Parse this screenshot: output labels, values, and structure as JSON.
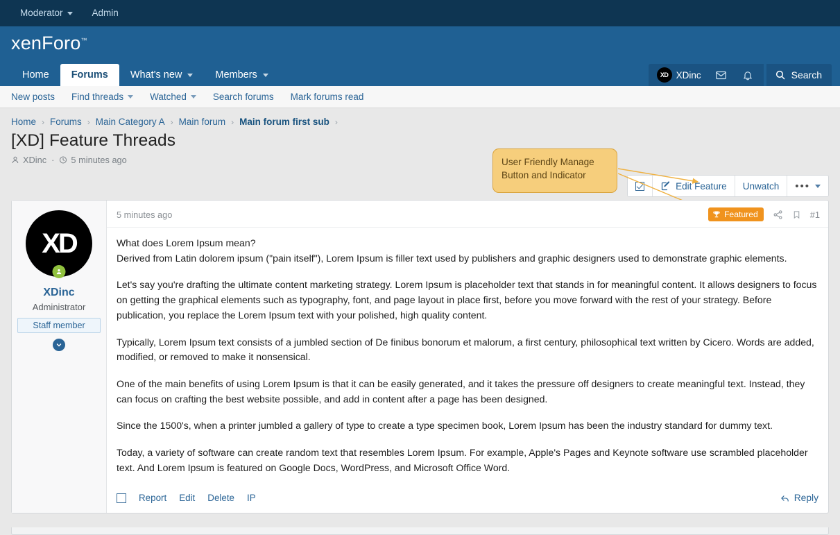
{
  "colors": {
    "top_strip": "#0e3552",
    "header": "#1f6093",
    "accent_link": "#2a6496",
    "featured_badge": "#f0931e",
    "callout_bg": "#f6ce7c",
    "callout_border": "#d9a33d",
    "online": "#90c13e",
    "page_bg": "#e8e8e8"
  },
  "admin_bar": {
    "items": [
      {
        "label": "Moderator",
        "icon": "chevron-down-icon",
        "has_caret": true
      },
      {
        "label": "Admin",
        "has_caret": false
      }
    ]
  },
  "header": {
    "logo_text_light": "xen",
    "logo_text_bold": "Foro",
    "logo_tm": "™",
    "user": {
      "name": "XDinc",
      "avatar_initials": "XD"
    },
    "icons": [
      {
        "name": "mail-icon"
      },
      {
        "name": "bell-icon"
      }
    ],
    "search_label": "Search",
    "search_icon": "search-icon"
  },
  "nav": {
    "tabs": [
      {
        "label": "Home",
        "active": false,
        "caret": false
      },
      {
        "label": "Forums",
        "active": true,
        "caret": false
      },
      {
        "label": "What's new",
        "active": false,
        "caret": true
      },
      {
        "label": "Members",
        "active": false,
        "caret": true
      }
    ]
  },
  "subnav": {
    "items": [
      {
        "label": "New posts",
        "caret": false
      },
      {
        "label": "Find threads",
        "caret": true
      },
      {
        "label": "Watched",
        "caret": true
      },
      {
        "label": "Search forums",
        "caret": false
      },
      {
        "label": "Mark forums read",
        "caret": false
      }
    ]
  },
  "breadcrumb": {
    "items": [
      {
        "label": "Home",
        "current": false
      },
      {
        "label": "Forums",
        "current": false
      },
      {
        "label": "Main Category A",
        "current": false
      },
      {
        "label": "Main forum",
        "current": false
      },
      {
        "label": "Main forum first sub",
        "current": true
      }
    ],
    "separator": "›"
  },
  "thread": {
    "title": "[XD] Feature Threads",
    "author": "XDinc",
    "author_icon": "user-icon",
    "time_icon": "clock-icon",
    "separator": "·",
    "posted": "5 minutes ago"
  },
  "callout": {
    "line1": "User Friendly Manage",
    "line2": "Button and Indicator"
  },
  "actions": {
    "checkbox": {
      "name": "select-thread-checkbox",
      "icon": "checkbox-checked-icon"
    },
    "edit_feature": {
      "label": "Edit Feature",
      "icon": "edit-square-icon"
    },
    "unwatch": {
      "label": "Unwatch"
    },
    "more": {
      "label": "•••",
      "icon": "ellipsis-icon"
    }
  },
  "post": {
    "timestamp": "5 minutes ago",
    "featured_badge": {
      "label": "Featured",
      "icon": "trophy-icon"
    },
    "share_icon": "share-icon",
    "bookmark_icon": "bookmark-icon",
    "post_number": "#1",
    "user": {
      "avatar_initials": "XD",
      "name": "XDinc",
      "title": "Administrator",
      "banner": "Staff member",
      "expand_icon": "chevron-down-circle-icon",
      "online_icon": "user-online-icon"
    },
    "paragraphs": [
      "What does Lorem Ipsum mean?",
      "Derived from Latin dolorem ipsum (\"pain itself\"), Lorem Ipsum is filler text used by publishers and graphic designers used to demonstrate graphic elements.",
      "Let's say you're drafting the ultimate content marketing strategy. Lorem Ipsum is placeholder text that stands in for meaningful content. It allows designers to focus on getting the graphical elements such as typography, font, and page layout in place first, before you move forward with the rest of your strategy. Before publication, you replace the Lorem Ipsum text with your polished, high quality content.",
      "Typically, Lorem Ipsum text consists of a jumbled section of De finibus bonorum et malorum, a first century, philosophical text written by Cicero. Words are added, modified, or removed to make it nonsensical.",
      "One of the main benefits of using Lorem Ipsum is that it can be easily generated, and it takes the pressure off designers to create meaningful text. Instead, they can focus on crafting the best website possible, and add in content after a page has been designed.",
      "Since the 1500's, when a printer jumbled a gallery of type to create a type specimen book, Lorem Ipsum has been the industry standard for dummy text.",
      "Today, a variety of software can create random text that resembles Lorem Ipsum. For example, Apple's Pages and Keynote software use scrambled placeholder text. And Lorem Ipsum is featured on Google Docs, WordPress, and Microsoft Office Word."
    ],
    "footer": {
      "select_icon": "checkbox-empty-icon",
      "links": [
        "Report",
        "Edit",
        "Delete",
        "IP"
      ],
      "reply": {
        "label": "Reply",
        "icon": "reply-arrow-icon"
      }
    }
  }
}
